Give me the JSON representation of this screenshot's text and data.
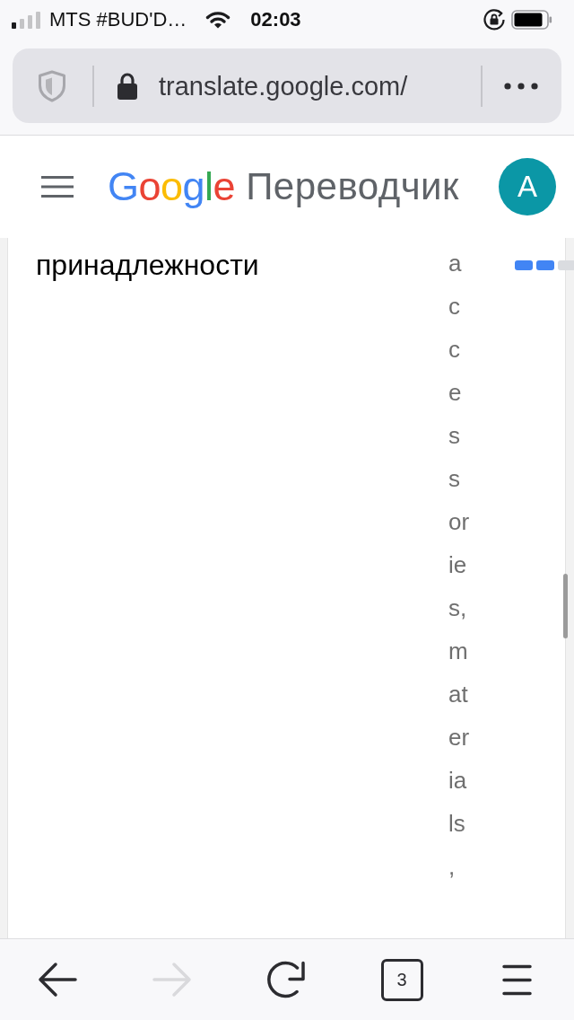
{
  "status_bar": {
    "carrier": "MTS #BUD'D…",
    "time": "02:03"
  },
  "address_bar": {
    "url": "translate.google.com/"
  },
  "header": {
    "logo": "Google",
    "title": "Переводчик",
    "avatar": "A"
  },
  "content": {
    "source_text": "принадлежности",
    "translation": "accessories, materials,",
    "progress_segments": [
      {
        "on": true
      },
      {
        "on": true
      },
      {
        "on": false
      }
    ]
  },
  "toolbar": [
    {
      "kind": "back",
      "disabled": false
    },
    {
      "kind": "forward",
      "disabled": true
    },
    {
      "kind": "reload",
      "disabled": false
    },
    {
      "kind": "tabs",
      "label": "3",
      "disabled": false
    },
    {
      "kind": "menu",
      "disabled": false
    }
  ]
}
